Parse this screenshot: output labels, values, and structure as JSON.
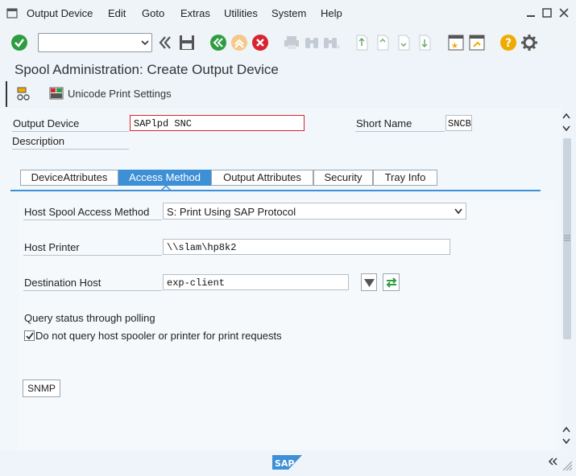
{
  "menu": {
    "items": [
      "Output Device",
      "Edit",
      "Goto",
      "Extras",
      "Utilities",
      "System",
      "Help"
    ]
  },
  "toolbar": {
    "command_value": ""
  },
  "page": {
    "title": "Spool Administration: Create Output Device"
  },
  "app_toolbar": {
    "unicode_label": "Unicode Print Settings"
  },
  "form": {
    "output_device_label": "Output Device",
    "output_device_value": "SAPlpd SNC",
    "short_name_label": "Short Name",
    "short_name_value": "SNCB",
    "description_label": "Description"
  },
  "tabs": [
    "DeviceAttributes",
    "Access Method",
    "Output Attributes",
    "Security",
    "Tray Info"
  ],
  "access": {
    "method_label": "Host Spool Access Method",
    "method_value": "S: Print Using SAP Protocol",
    "host_printer_label": "Host Printer",
    "host_printer_value": "\\\\slam\\hp8k2",
    "dest_host_label": "Destination Host",
    "dest_host_value": "exp-client",
    "query_heading": "Query status through polling",
    "checkbox_label": "Do not query host spooler or printer for print requests",
    "checkbox_checked": true,
    "snmp_label": "SNMP"
  },
  "colors": {
    "accent": "#3d8fd6",
    "ok_green": "#2e9d42",
    "cancel_red": "#d9232e",
    "help_yellow": "#f0ab00"
  }
}
